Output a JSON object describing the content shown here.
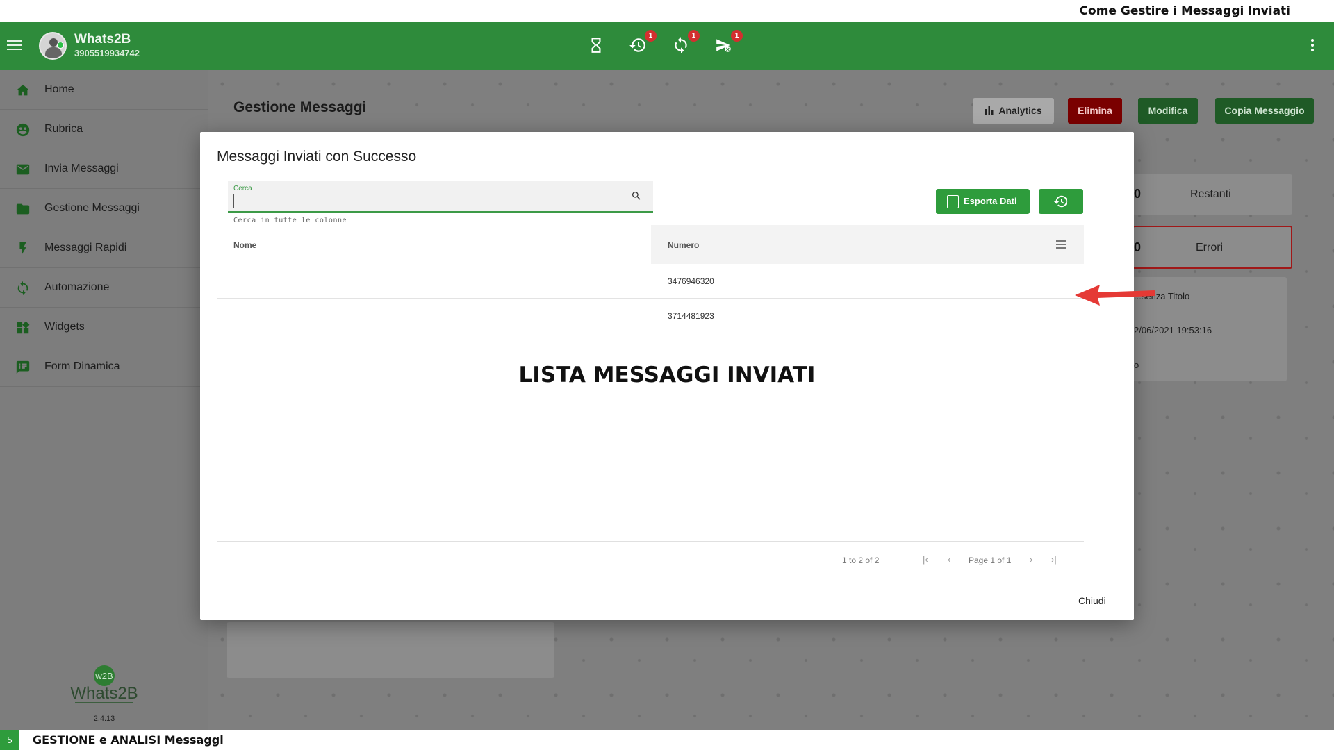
{
  "caption_top": "Come Gestire i Messaggi Inviati",
  "appbar": {
    "brand": "Whats2B",
    "phone": "3905519934742",
    "badges": [
      "1",
      "1",
      "1"
    ]
  },
  "sidebar": {
    "items": [
      {
        "label": "Home",
        "icon": "home-icon"
      },
      {
        "label": "Rubrica",
        "icon": "contacts-icon"
      },
      {
        "label": "Invia Messaggi",
        "icon": "mail-icon"
      },
      {
        "label": "Gestione Messaggi",
        "icon": "folder-icon"
      },
      {
        "label": "Messaggi Rapidi",
        "icon": "bolt-icon"
      },
      {
        "label": "Automazione",
        "icon": "sync-icon"
      },
      {
        "label": "Widgets",
        "icon": "widgets-icon"
      },
      {
        "label": "Form Dinamica",
        "icon": "form-icon"
      }
    ],
    "logo_text": "Whats2B",
    "logo_mark": "w2B",
    "version": "2.4.13"
  },
  "main": {
    "title": "Gestione Messaggi",
    "buttons": {
      "analytics": "Analytics",
      "elimina": "Elimina",
      "modifica": "Modifica",
      "copia": "Copia Messaggio"
    },
    "stats": {
      "restanti_value": "0",
      "restanti_label": "Restanti",
      "errori_value": "0",
      "errori_label": "Errori"
    },
    "info": [
      "...senza Titolo",
      "2/06/2021 19:53:16",
      "o"
    ]
  },
  "modal": {
    "title": "Messaggi Inviati con Successo",
    "search_label": "Cerca",
    "search_value": "",
    "search_hint": "Cerca in tutte le colonne",
    "export_label": "Esporta Dati",
    "columns": [
      "Nome",
      "Numero"
    ],
    "rows": [
      {
        "nome": "",
        "numero": "3476946320"
      },
      {
        "nome": "",
        "numero": "3714481923"
      }
    ],
    "overlay_caption": "LISTA MESSAGGI INVIATI",
    "pager": {
      "summary": "1 to 2 of 2",
      "page_text": "Page 1 of 1"
    },
    "close_label": "Chiudi"
  },
  "caption_bottom": {
    "number": "5",
    "text": "GESTIONE e ANALISI Messaggi"
  },
  "colors": {
    "primary_green": "#2e8b3b",
    "button_green": "#2e9c3c",
    "danger_red": "#c40000",
    "arrow_red": "#e53935"
  }
}
